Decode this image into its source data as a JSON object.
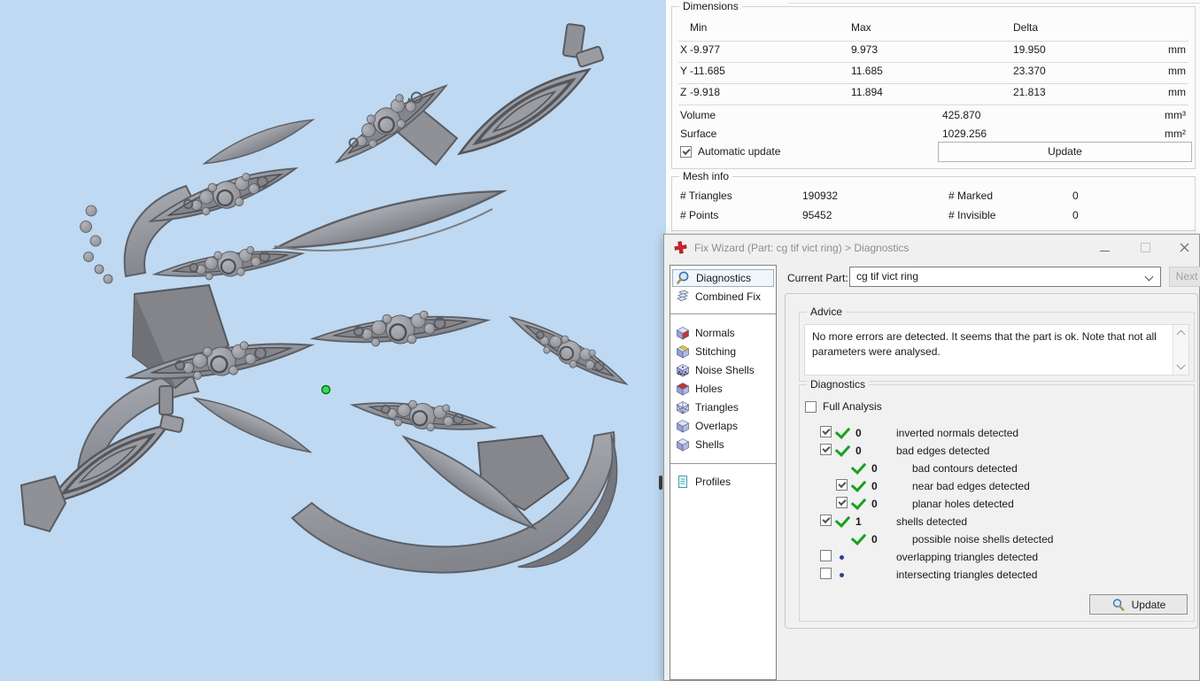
{
  "viewport": {
    "background": "#bed9f1",
    "model": "gray leaf bypass ring with gem settings",
    "marker_color": "#2fe154"
  },
  "panels": {
    "dimensions": {
      "title": "Dimensions",
      "columns": [
        "Min",
        "Max",
        "Delta"
      ],
      "rows": [
        {
          "axis": "X",
          "min": "-9.977",
          "max": "9.973",
          "delta": "19.950",
          "unit": "mm"
        },
        {
          "axis": "Y",
          "min": "-11.685",
          "max": "11.685",
          "delta": "23.370",
          "unit": "mm"
        },
        {
          "axis": "Z",
          "min": "-9.918",
          "max": "11.894",
          "delta": "21.813",
          "unit": "mm"
        }
      ],
      "volume": {
        "label": "Volume",
        "value": "425.870",
        "unit": "mm³"
      },
      "surface": {
        "label": "Surface",
        "value": "1029.256",
        "unit": "mm²"
      },
      "auto_update_label": "Automatic update",
      "auto_update_checked": true,
      "update_button": "Update"
    },
    "mesh_info": {
      "title": "Mesh info",
      "triangles_label": "# Triangles",
      "triangles_value": "190932",
      "points_label": "# Points",
      "points_value": "95452",
      "marked_label": "# Marked",
      "marked_value": "0",
      "invisible_label": "# Invisible",
      "invisible_value": "0"
    }
  },
  "fix_wizard": {
    "title": "Fix Wizard (Part: cg tif vict ring) > Diagnostics",
    "current_part_label": "Current Part:",
    "current_part_value": "cg tif vict ring",
    "next_button": "Next",
    "sidebar": {
      "top": [
        {
          "label": "Diagnostics",
          "icon": "magnifier-icon",
          "selected": true
        },
        {
          "label": "Combined Fix",
          "icon": "layers-icon",
          "selected": false
        }
      ],
      "middle": [
        {
          "label": "Normals",
          "icon": "cube-red-front-icon"
        },
        {
          "label": "Stitching",
          "icon": "cube-stitch-icon"
        },
        {
          "label": "Noise Shells",
          "icon": "cube-dots-icon"
        },
        {
          "label": "Holes",
          "icon": "cube-red-top-icon"
        },
        {
          "label": "Triangles",
          "icon": "cube-wireframe-icon"
        },
        {
          "label": "Overlaps",
          "icon": "cube-icon"
        },
        {
          "label": "Shells",
          "icon": "cube-icon"
        }
      ],
      "bottom": [
        {
          "label": "Profiles",
          "icon": "document-icon"
        }
      ]
    },
    "advice": {
      "title": "Advice",
      "text": "No more errors are detected. It seems that the part is ok. Note that not all parameters were analysed."
    },
    "diagnostics": {
      "title": "Diagnostics",
      "full_analysis_label": "Full Analysis",
      "full_analysis_checked": false,
      "checks": [
        {
          "indent": 0,
          "checkbox": "checked",
          "status": "ok",
          "count": "0",
          "label": "inverted normals detected"
        },
        {
          "indent": 0,
          "checkbox": "checked",
          "status": "ok",
          "count": "0",
          "label": "bad edges detected"
        },
        {
          "indent": 1,
          "checkbox": "none",
          "status": "ok",
          "count": "0",
          "label": "bad contours detected"
        },
        {
          "indent": 1,
          "checkbox": "checked",
          "status": "ok",
          "count": "0",
          "label": "near bad edges detected"
        },
        {
          "indent": 1,
          "checkbox": "checked",
          "status": "ok",
          "count": "0",
          "label": "planar holes detected"
        },
        {
          "indent": 0,
          "checkbox": "checked",
          "status": "ok",
          "count": "1",
          "label": "shells detected"
        },
        {
          "indent": 1,
          "checkbox": "none",
          "status": "ok",
          "count": "0",
          "label": "possible noise shells detected"
        },
        {
          "indent": 0,
          "checkbox": "unchecked",
          "status": "dot",
          "count": "",
          "label": "overlapping triangles detected"
        },
        {
          "indent": 0,
          "checkbox": "unchecked",
          "status": "dot",
          "count": "",
          "label": "intersecting triangles detected"
        }
      ],
      "update_button": "Update"
    }
  },
  "colors": {
    "ok_green": "#17a11f",
    "pending_blue": "#2c3f92",
    "wizard_icon_red": "#d22027",
    "viewport_bg": "#bed9f1"
  }
}
